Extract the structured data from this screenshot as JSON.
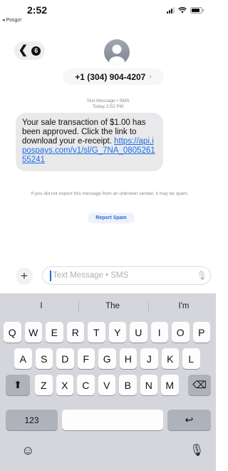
{
  "status_bar": {
    "time": "2:52",
    "back_app": "◂ Posgo!"
  },
  "nav": {
    "back_chevron": "❮",
    "unread_count": "6"
  },
  "contact": {
    "name": "+1 (304) 904-4207",
    "chevron": "›"
  },
  "thread": {
    "service_label": "Text Message • SMS",
    "timestamp": "Today 2:52 PM",
    "message_text": "Your sale transaction of $1.00 has been approved. Click the link to download your e-receipt.",
    "message_link": "https://api.ipospays.com/v1/sl/G_7NA_080526155241",
    "spam_note": "If you did not expect this message from an unknown sender, it may be spam.",
    "report_label": "Report Spam"
  },
  "compose": {
    "plus": "+",
    "placeholder": "Text Message • SMS",
    "mic": "🎙"
  },
  "keyboard": {
    "suggestions": [
      "I",
      "The",
      "I'm"
    ],
    "row1": [
      "Q",
      "W",
      "E",
      "R",
      "T",
      "Y",
      "U",
      "I",
      "O",
      "P"
    ],
    "row2": [
      "A",
      "S",
      "D",
      "F",
      "G",
      "H",
      "J",
      "K",
      "L"
    ],
    "row3": [
      "Z",
      "X",
      "C",
      "V",
      "B",
      "N",
      "M"
    ],
    "shift": "⬆",
    "delete": "⌫",
    "numbers": "123",
    "return": "↩",
    "emoji": "☺",
    "dictation": "🎙"
  },
  "colors": {
    "link": "#1a6ee6",
    "bubble": "#e9e9eb",
    "keyboard_bg": "#d4d6dc"
  }
}
